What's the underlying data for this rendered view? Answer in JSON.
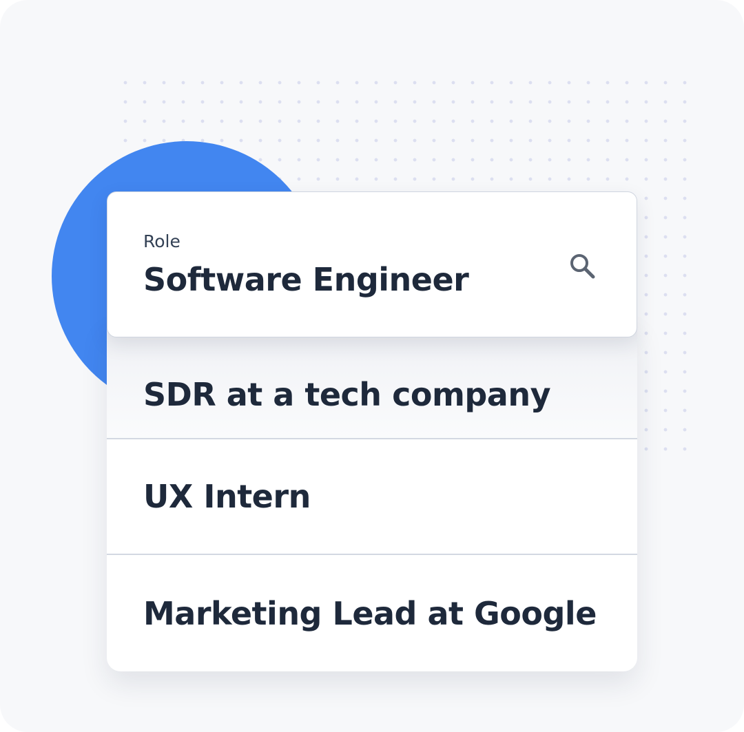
{
  "role_field": {
    "label": "Role",
    "value": "Software Engineer",
    "icon": "search-icon"
  },
  "suggestions": [
    {
      "label": "SDR at a tech company"
    },
    {
      "label": "UX Intern"
    },
    {
      "label": "Marketing Lead at Google"
    }
  ],
  "colors": {
    "accent": "#4286f0",
    "text": "#1e293b",
    "background": "#f7f8fa",
    "icon": "#5b6472"
  }
}
